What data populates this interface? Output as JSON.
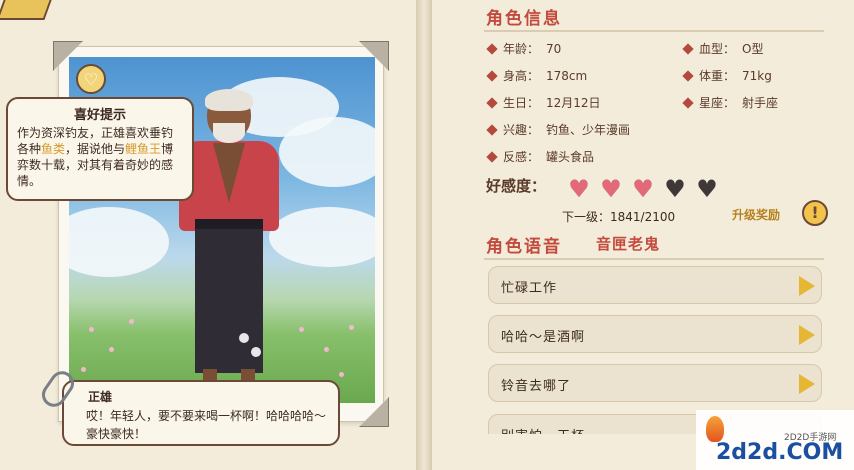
{
  "hint": {
    "title": "喜好提示",
    "text_1": "作为资深钓友，正雄喜欢垂钓各种",
    "highlight_1": "鱼类",
    "text_2": "，据说他与",
    "highlight_2": "鲤鱼王",
    "text_3": "博弈数十载，对其有着奇妙的感情。"
  },
  "quote": {
    "name": "正雄",
    "text": "哎！年轻人，要不要来喝一杯啊！哈哈哈哈～豪快豪快！"
  },
  "info": {
    "title": "角色信息",
    "rows": [
      {
        "key": "年龄：",
        "value": "70"
      },
      {
        "key": "血型：",
        "value": "O型"
      },
      {
        "key": "身高：",
        "value": "178cm"
      },
      {
        "key": "体重：",
        "value": "71kg"
      },
      {
        "key": "生日：",
        "value": "12月12日"
      },
      {
        "key": "星座：",
        "value": "射手座"
      },
      {
        "key": "兴趣：",
        "value": "钓鱼、少年漫画"
      },
      {
        "key": "反感：",
        "value": "罐头食品"
      }
    ]
  },
  "favor": {
    "label": "好感度：",
    "hearts_filled": 3,
    "hearts_total": 5,
    "next_level": "下一级：1841/2100",
    "reward": "升级奖励"
  },
  "voice": {
    "title": "角色语音",
    "voice_actor": "音匣老鬼",
    "items": [
      "忙碌工作",
      "哈哈～是酒啊",
      "铃音去哪了",
      "别害怕，干杯"
    ]
  },
  "watermark": {
    "site": "2D2D手游网",
    "domain": "2d2d.COM"
  },
  "colors": {
    "accent_red": "#c24b3e",
    "heart_on": "#e26a78",
    "heart_off": "#3e3836",
    "play": "#e6b635",
    "highlight": "#d79a2a"
  }
}
